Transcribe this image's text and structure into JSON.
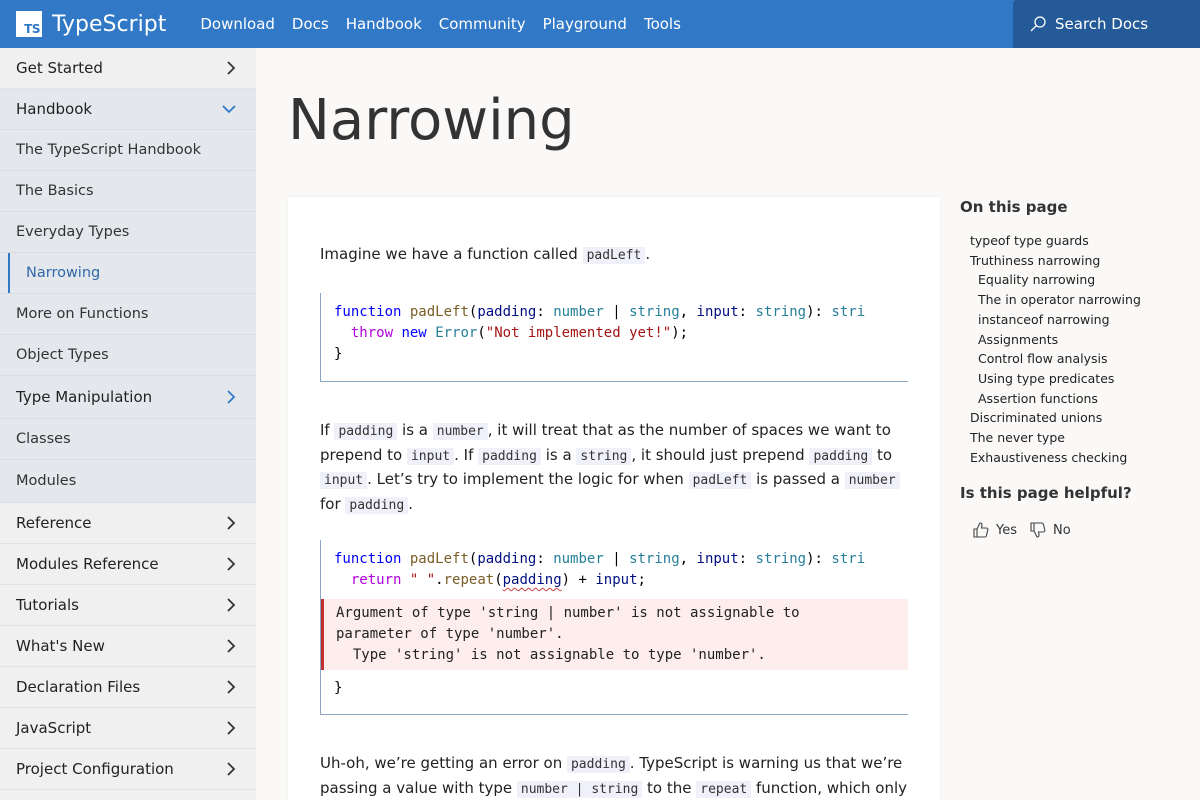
{
  "brand": {
    "logo_text": "TS",
    "name": "TypeScript",
    "accent": "#3178c6"
  },
  "nav": {
    "links": [
      "Download",
      "Docs",
      "Handbook",
      "Community",
      "Playground",
      "Tools"
    ],
    "search_label": "Search Docs"
  },
  "sidebar": {
    "get_started": "Get Started",
    "handbook": "Handbook",
    "handbook_items": [
      "The TypeScript Handbook",
      "The Basics",
      "Everyday Types",
      "Narrowing",
      "More on Functions",
      "Object Types"
    ],
    "type_manipulation": "Type Manipulation",
    "handbook_items_2": [
      "Classes",
      "Modules"
    ],
    "sections": [
      "Reference",
      "Modules Reference",
      "Tutorials",
      "What's New",
      "Declaration Files",
      "JavaScript",
      "Project Configuration"
    ],
    "active_item": "Narrowing"
  },
  "page": {
    "title": "Narrowing",
    "p1": {
      "text": "Imagine we have a function called ",
      "code": "padLeft",
      "end": "."
    },
    "code1": {
      "line1": {
        "kw": "function",
        "fn": "padLeft",
        "p1": "padding",
        "t1": "number",
        "t2": "string",
        "p2": "input",
        "t3": "string",
        "t4": "stri"
      },
      "line2": {
        "kw": "throw",
        "kw2": "new",
        "cls": "Error",
        "str": "\"Not implemented yet!\""
      },
      "line3": "}"
    },
    "p2": {
      "parts": [
        "If ",
        "padding",
        " is a ",
        "number",
        ", it will treat that as the number of spaces we want to prepend to ",
        "input",
        ". If ",
        "padding",
        " is a ",
        "string",
        ", it should just prepend ",
        "padding",
        " to ",
        "input",
        ". Let’s try to implement the logic for when ",
        "padLeft",
        " is passed a ",
        "number",
        " for ",
        "padding",
        "."
      ]
    },
    "code2": {
      "line1": {
        "kw": "function",
        "fn": "padLeft",
        "p1": "padding",
        "t1": "number",
        "t2": "string",
        "p2": "input",
        "t3": "string",
        "t4": "stri"
      },
      "line2": {
        "kw": "return",
        "str": "\" \"",
        "method": "repeat",
        "arg": "padding",
        "rest": "input"
      },
      "error_line1": "Argument of type 'string | number' is not assignable to",
      "error_line2": "parameter of type 'number'.",
      "error_line3": "  Type 'string' is not assignable to type 'number'.",
      "line3": "}"
    },
    "p3": {
      "parts": [
        "Uh-oh, we’re getting an error on ",
        "padding",
        ". TypeScript is warning us that we’re passing a value with type ",
        "number | string",
        " to the ",
        "repeat",
        " function, which only"
      ]
    }
  },
  "toc": {
    "heading": "On this page",
    "items": [
      {
        "label": "typeof type guards",
        "level": 1
      },
      {
        "label": "Truthiness narrowing",
        "level": 1
      },
      {
        "label": "Equality narrowing",
        "level": 2
      },
      {
        "label": "The in operator narrowing",
        "level": 2
      },
      {
        "label": "instanceof narrowing",
        "level": 2
      },
      {
        "label": "Assignments",
        "level": 2
      },
      {
        "label": "Control flow analysis",
        "level": 2
      },
      {
        "label": "Using type predicates",
        "level": 2
      },
      {
        "label": "Assertion functions",
        "level": 2
      },
      {
        "label": "Discriminated unions",
        "level": 1
      },
      {
        "label": "The never type",
        "level": 1
      },
      {
        "label": "Exhaustiveness checking",
        "level": 1
      }
    ],
    "helpful_heading": "Is this page helpful?",
    "yes_label": "Yes",
    "no_label": "No"
  }
}
